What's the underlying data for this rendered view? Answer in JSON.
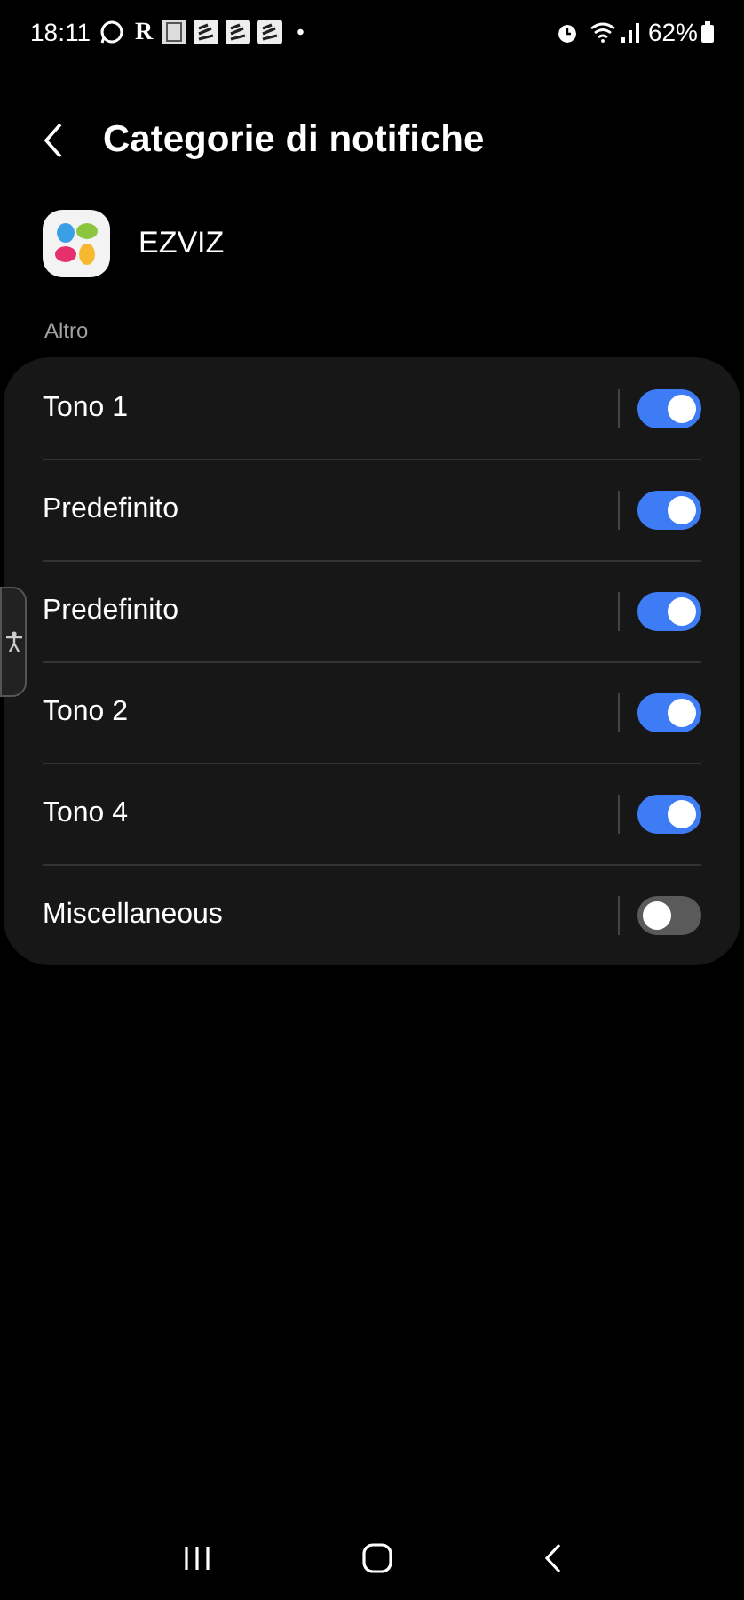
{
  "status_bar": {
    "time": "18:11",
    "letter_icon": "R",
    "dot": "•",
    "battery": "62%"
  },
  "header": {
    "title": "Categorie di notifiche"
  },
  "app": {
    "name": "EZVIZ"
  },
  "section": {
    "title": "Altro"
  },
  "categories": [
    {
      "label": "Tono 1",
      "on": true
    },
    {
      "label": "Predefinito",
      "on": true
    },
    {
      "label": "Predefinito",
      "on": true
    },
    {
      "label": "Tono 2",
      "on": true
    },
    {
      "label": "Tono 4",
      "on": true
    },
    {
      "label": "Miscellaneous",
      "on": false
    }
  ]
}
